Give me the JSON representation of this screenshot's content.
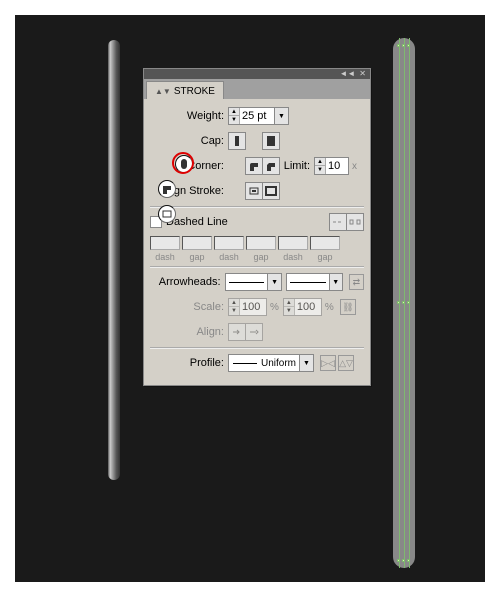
{
  "panel": {
    "title": "STROKE",
    "weight_label": "Weight:",
    "weight_value": "25 pt",
    "cap_label": "Cap:",
    "corner_label": "Corner:",
    "limit_label": "Limit:",
    "limit_value": "10",
    "limit_suffix": "x",
    "align_label": "Align Stroke:",
    "dashed_label": "Dashed Line",
    "dash_cols": [
      "dash",
      "gap",
      "dash",
      "gap",
      "dash",
      "gap"
    ],
    "arrow_label": "Arrowheads:",
    "scale_label": "Scale:",
    "scale_a": "100",
    "scale_b": "100",
    "pct": "%",
    "align2_label": "Align:",
    "profile_label": "Profile:",
    "profile_value": "Uniform"
  }
}
